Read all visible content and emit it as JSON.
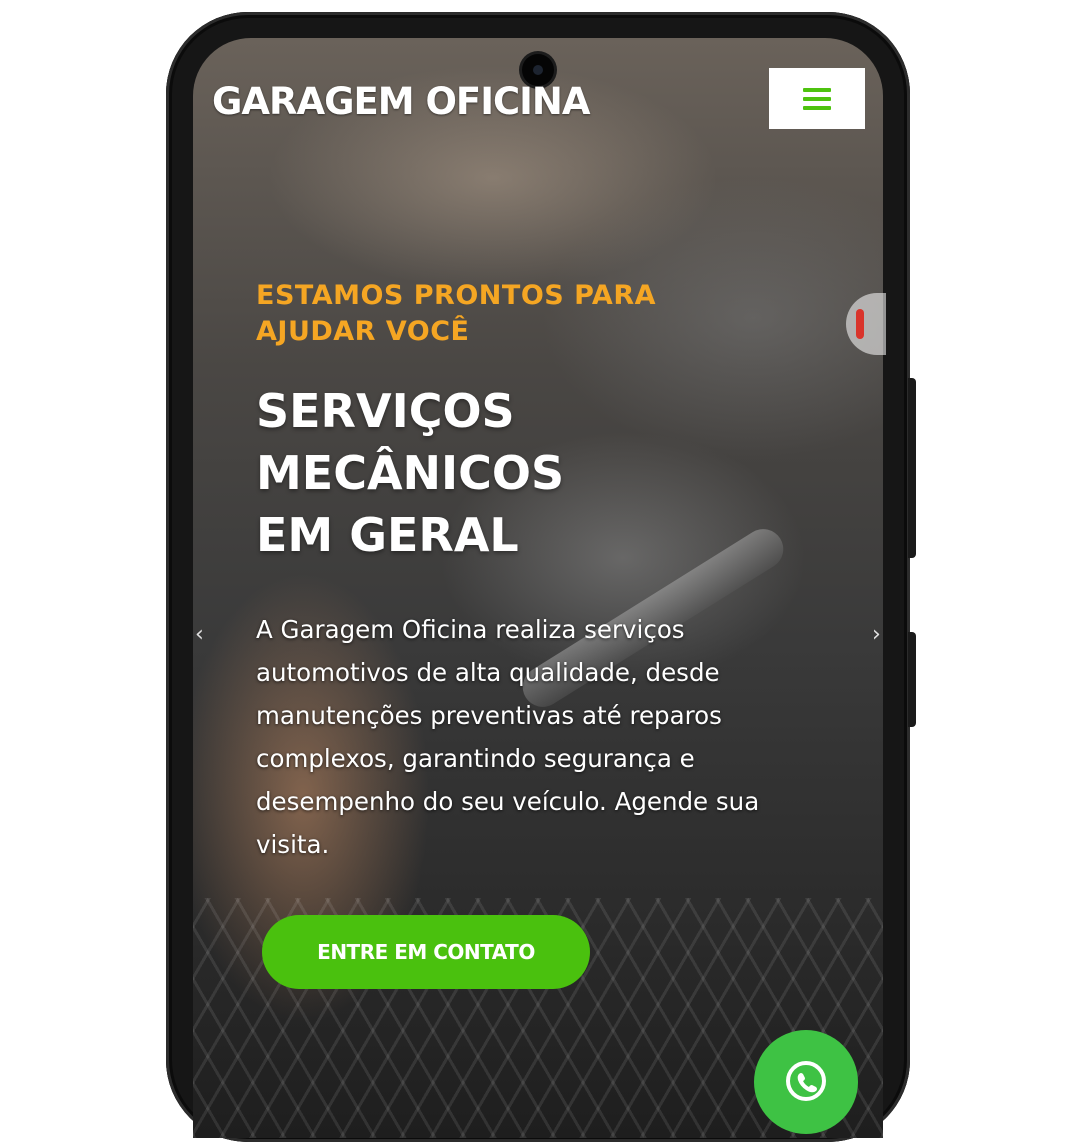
{
  "header": {
    "brand": "GARAGEM OFICINA",
    "menu_icon": "hamburger-menu-icon",
    "menu_color": "#4ec30f"
  },
  "hero": {
    "eyebrow": "ESTAMOS PRONTOS PARA AJUDAR VOCÊ",
    "headline_lines": [
      "SERVIÇOS",
      "MECÂNICOS",
      "EM GERAL"
    ],
    "description": "A Garagem Oficina realiza serviços automotivos de alta qualidade, desde manutenções preventivas até reparos complexos, garantindo segurança e desempenho do seu veículo. Agende sua visita.",
    "cta_label": "ENTRE EM CONTATO",
    "cta_color": "#4ac10e",
    "eyebrow_color": "#f5a623"
  },
  "floating": {
    "whatsapp_icon": "whatsapp-icon",
    "whatsapp_color": "#3ec244"
  },
  "carousel": {
    "prev_icon": "chevron-left-icon",
    "next_icon": "chevron-right-icon"
  }
}
